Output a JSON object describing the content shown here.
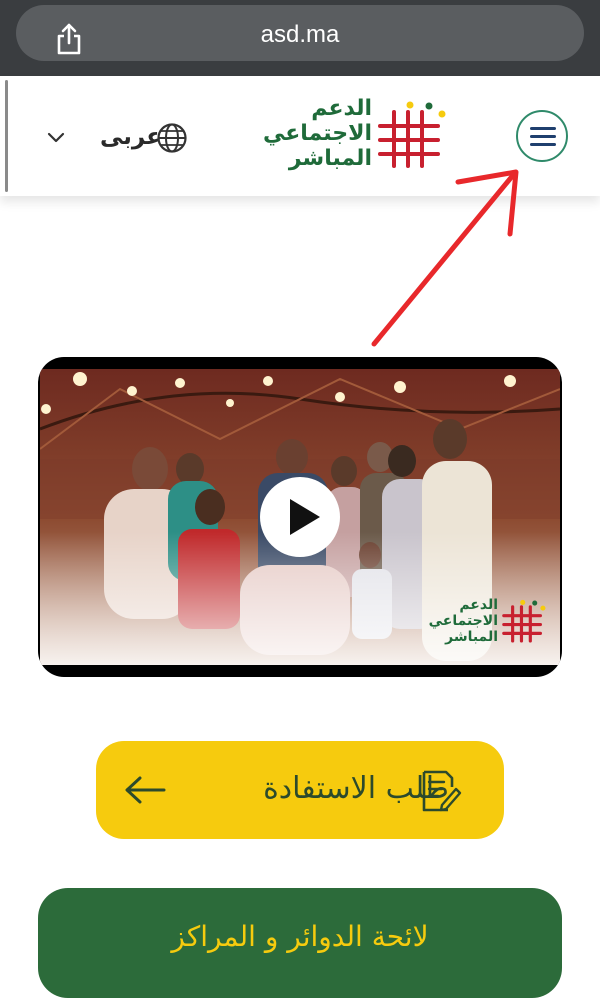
{
  "browser": {
    "url": "asd.ma",
    "share_icon": "share-icon"
  },
  "header": {
    "language_label": "عربى",
    "language_chevron_icon": "chevron-down-icon",
    "globe_icon": "globe-icon",
    "logo": {
      "line1": "الدعم",
      "line2": "الاجتماعي",
      "line3": "المباشر"
    },
    "menu_icon": "hamburger-menu-icon"
  },
  "video": {
    "play_icon": "play-icon",
    "logo": {
      "line1": "الدعم",
      "line2": "الاجتماعي",
      "line3": "المباشر"
    }
  },
  "actions": {
    "apply_label": "طلب الاستفادة",
    "apply_arrow_icon": "arrow-left-icon",
    "apply_doc_icon": "document-edit-icon",
    "offices_label": "لائحة الدوائر و المراكز"
  },
  "colors": {
    "brand_green": "#1f6b3a",
    "brand_red": "#c8202f",
    "brand_yellow": "#f6cb0e",
    "annotation_red": "#e8282b"
  }
}
